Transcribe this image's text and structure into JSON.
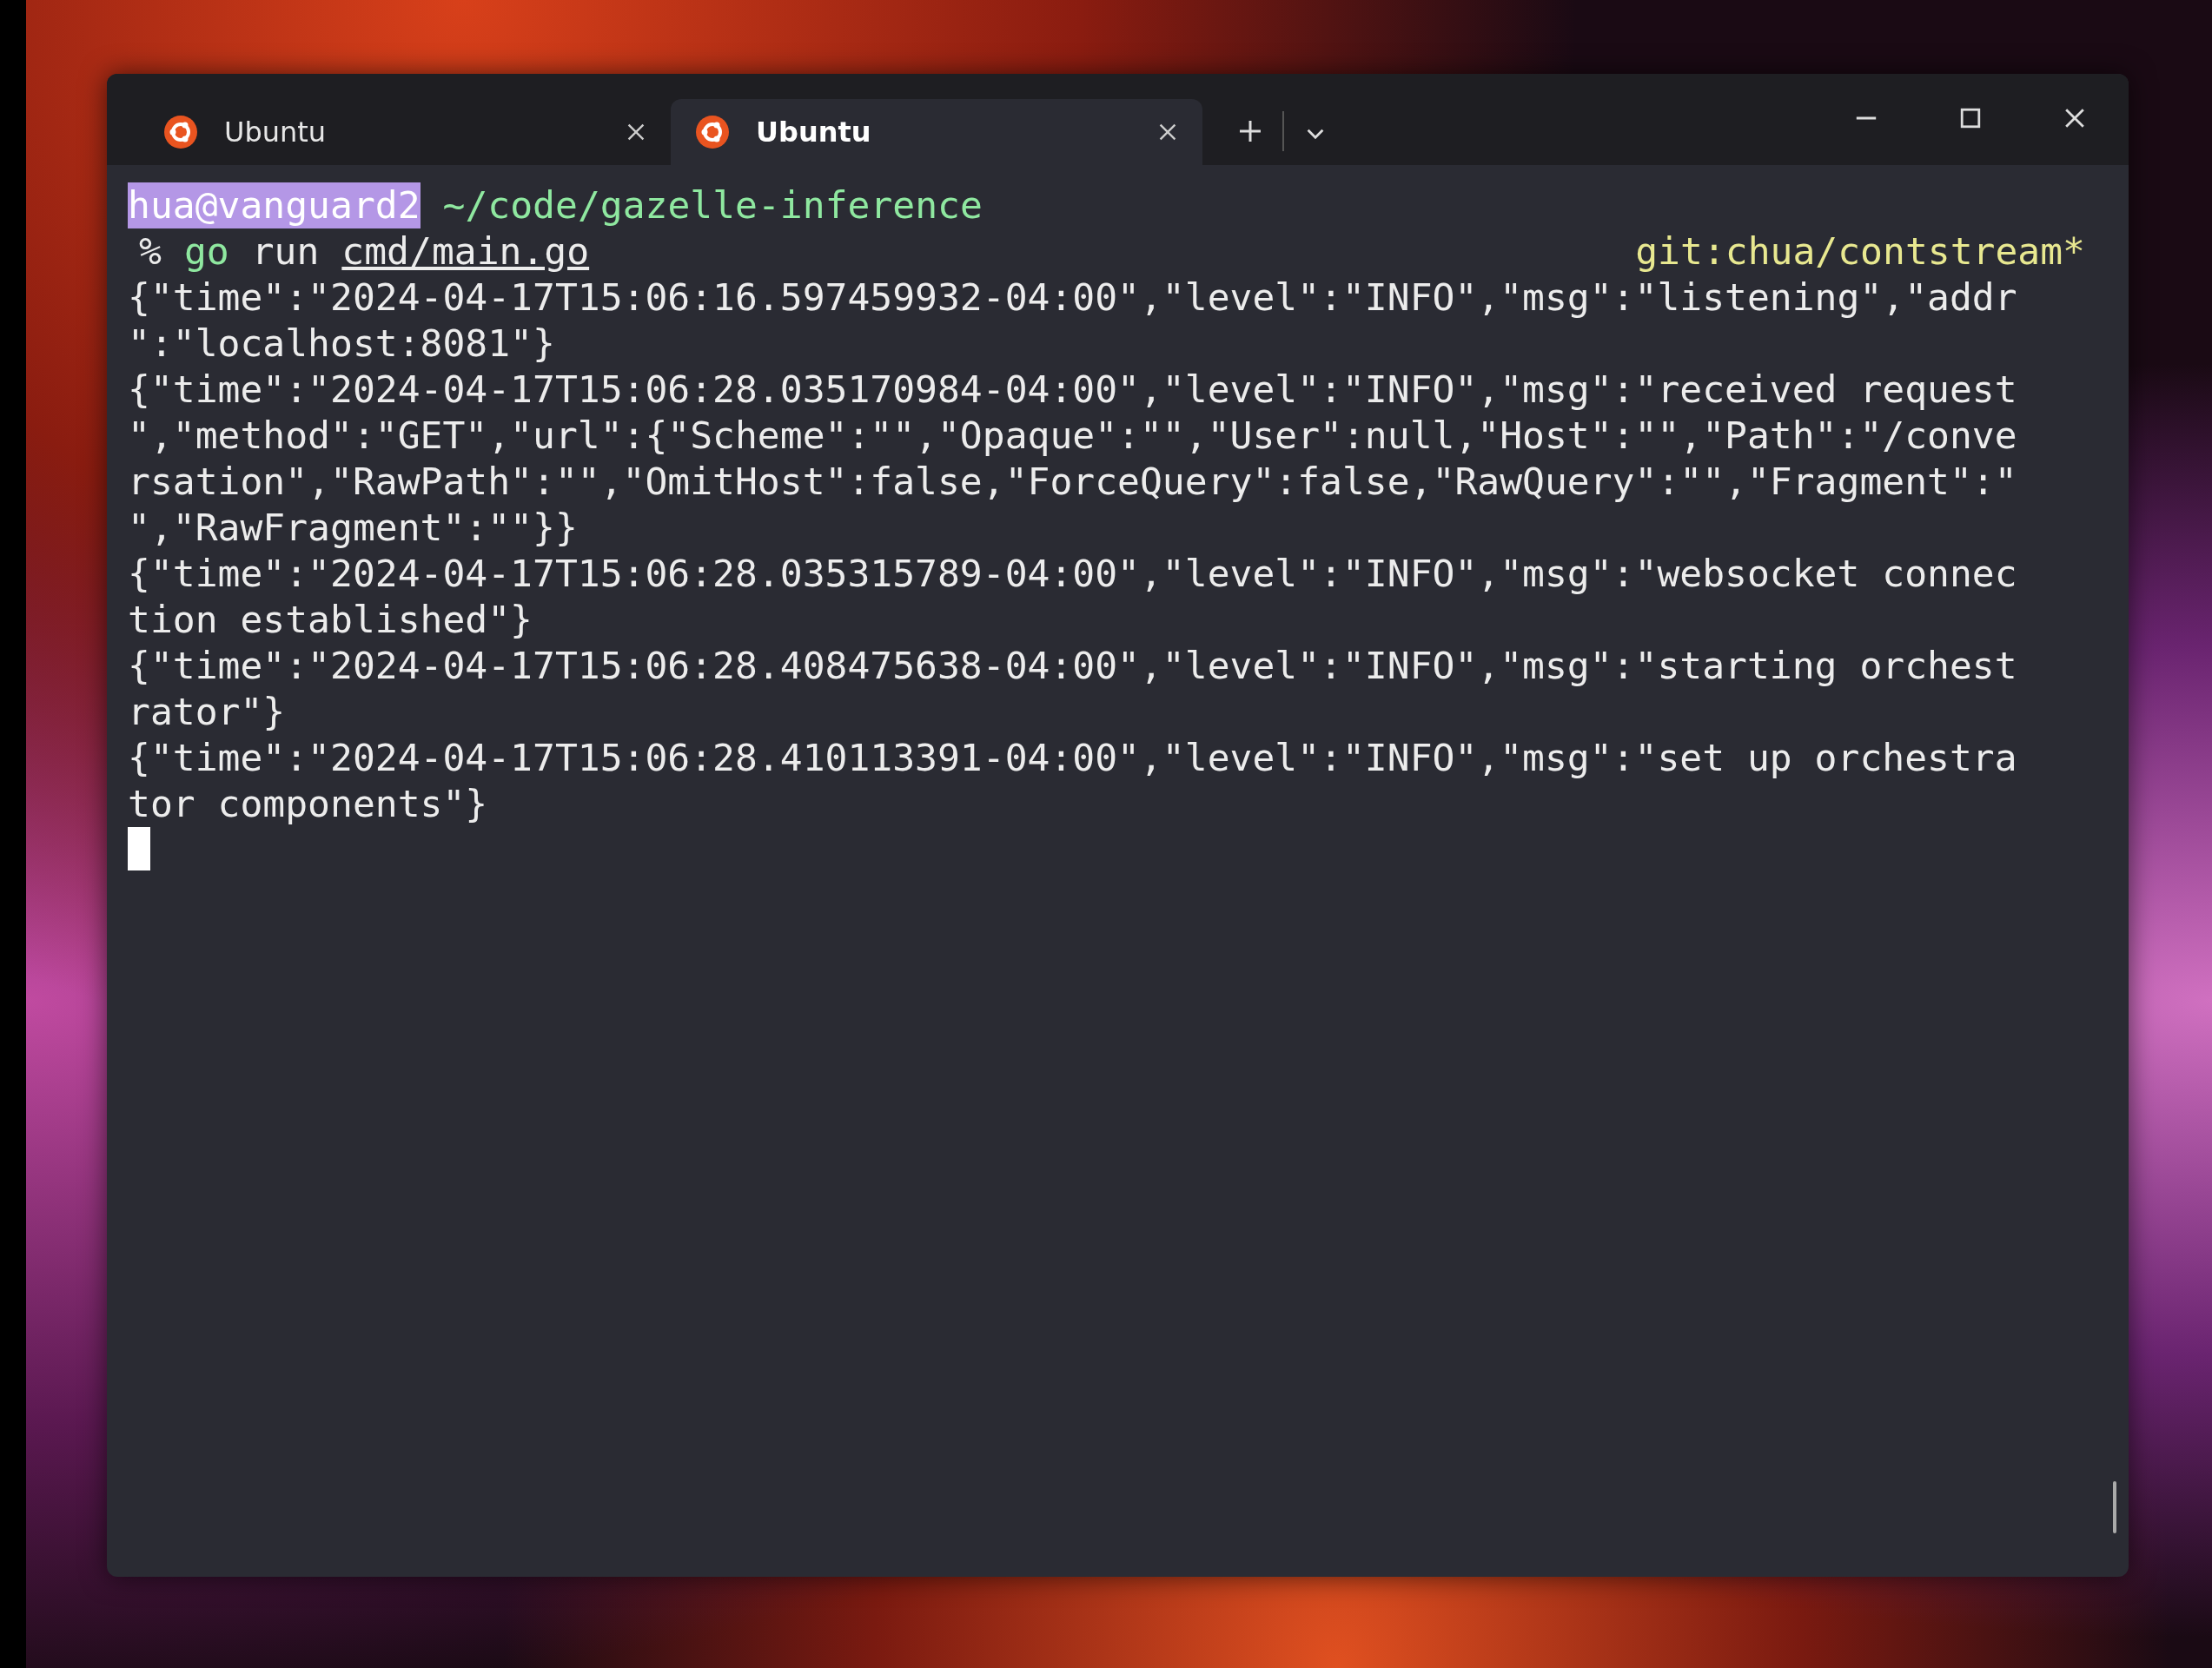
{
  "window": {
    "tabs": [
      {
        "label": "Ubuntu",
        "selected": false
      },
      {
        "label": "Ubuntu",
        "selected": true
      }
    ]
  },
  "terminal": {
    "prompt": {
      "user": "hua@vanguard2",
      "path": "~/code/gazelle-inference"
    },
    "command": {
      "symbol": "%",
      "program": "go",
      "args": "run",
      "file": "cmd/main.go",
      "git": "git:chua/contstream*"
    },
    "output": [
      "{\"time\":\"2024-04-17T15:06:16.597459932-04:00\",\"level\":\"INFO\",\"msg\":\"listening\",\"addr",
      "\":\"localhost:8081\"}",
      "{\"time\":\"2024-04-17T15:06:28.035170984-04:00\",\"level\":\"INFO\",\"msg\":\"received request",
      "\",\"method\":\"GET\",\"url\":{\"Scheme\":\"\",\"Opaque\":\"\",\"User\":null,\"Host\":\"\",\"Path\":\"/conve",
      "rsation\",\"RawPath\":\"\",\"OmitHost\":false,\"ForceQuery\":false,\"RawQuery\":\"\",\"Fragment\":\"",
      "\",\"RawFragment\":\"\"}}",
      "{\"time\":\"2024-04-17T15:06:28.035315789-04:00\",\"level\":\"INFO\",\"msg\":\"websocket connec",
      "tion established\"}",
      "{\"time\":\"2024-04-17T15:06:28.408475638-04:00\",\"level\":\"INFO\",\"msg\":\"starting orchest",
      "rator\"}",
      "{\"time\":\"2024-04-17T15:06:28.410113391-04:00\",\"level\":\"INFO\",\"msg\":\"set up orchestra",
      "tor components\"}"
    ],
    "cursor_visible": true
  }
}
